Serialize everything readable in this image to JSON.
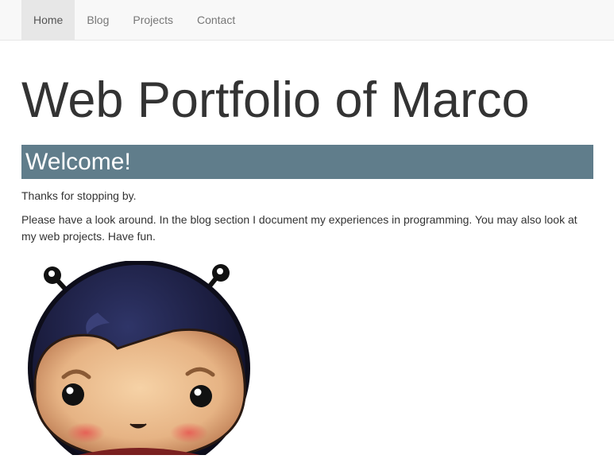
{
  "nav": {
    "items": [
      {
        "label": "Home",
        "active": true
      },
      {
        "label": "Blog",
        "active": false
      },
      {
        "label": "Projects",
        "active": false
      },
      {
        "label": "Contact",
        "active": false
      }
    ]
  },
  "main": {
    "title": "Web Portfolio of Marco",
    "welcome_heading": "Welcome!",
    "paragraphs": [
      "Thanks for stopping by.",
      "Please have a look around. In the blog section I document my experiences in programming. You may also look at my web projects. Have fun."
    ],
    "avatar_icon": "cartoon-ladybug-avatar-icon"
  },
  "colors": {
    "navbar_bg": "#f8f8f8",
    "nav_active_bg": "#e7e7e7",
    "nav_text": "#777777",
    "welcome_bar": "#607d8b",
    "body_text": "#333333"
  }
}
